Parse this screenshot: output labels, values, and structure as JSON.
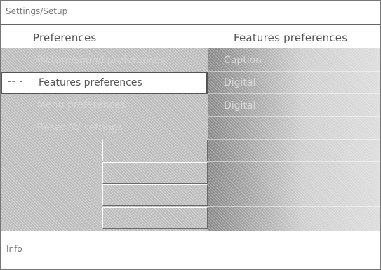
{
  "topbar": {
    "title": "Settings/Setup"
  },
  "left_header": "Preferences",
  "right_header": "Features preferences",
  "menu": [
    {
      "label": "Picture/sound preferences",
      "selected": false
    },
    {
      "label": "Features preferences",
      "selected": true
    },
    {
      "label": "Menu preferences",
      "selected": false
    },
    {
      "label": "Reset AV settings",
      "selected": false
    }
  ],
  "submenu": [
    "Caption",
    "Digital",
    "Digital"
  ],
  "selected_arrow": "-- -",
  "footer": {
    "info": "Info"
  }
}
